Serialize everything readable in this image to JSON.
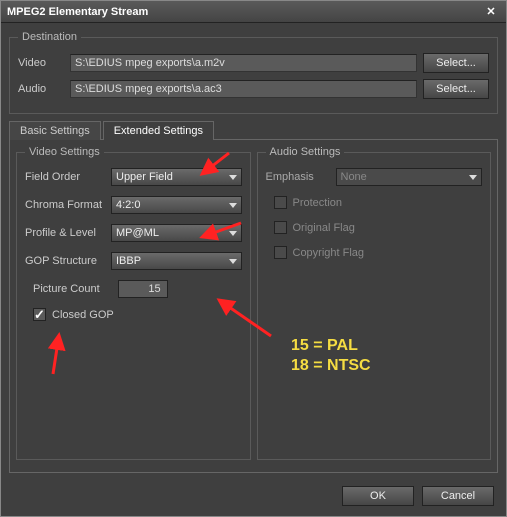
{
  "title": "MPEG2 Elementary Stream",
  "destination": {
    "legend": "Destination",
    "video_label": "Video",
    "video_path": "S:\\EDIUS mpeg exports\\a.m2v",
    "audio_label": "Audio",
    "audio_path": "S:\\EDIUS mpeg exports\\a.ac3",
    "select_label": "Select..."
  },
  "tabs": {
    "basic": "Basic Settings",
    "extended": "Extended Settings"
  },
  "video_settings": {
    "legend": "Video Settings",
    "field_order": {
      "label": "Field Order",
      "value": "Upper Field"
    },
    "chroma": {
      "label": "Chroma Format",
      "value": "4:2:0"
    },
    "profile": {
      "label": "Profile & Level",
      "value": "MP@ML"
    },
    "gop": {
      "label": "GOP Structure",
      "value": "IBBP"
    },
    "picture_count": {
      "label": "Picture Count",
      "value": "15"
    },
    "closed_gop": {
      "label": "Closed GOP",
      "checked": true
    }
  },
  "audio_settings": {
    "legend": "Audio Settings",
    "emphasis": {
      "label": "Emphasis",
      "value": "None"
    },
    "protection": "Protection",
    "original": "Original Flag",
    "copyright": "Copyright Flag"
  },
  "annotation": {
    "line1": "15 = PAL",
    "line2": "18 = NTSC"
  },
  "footer": {
    "ok": "OK",
    "cancel": "Cancel"
  }
}
